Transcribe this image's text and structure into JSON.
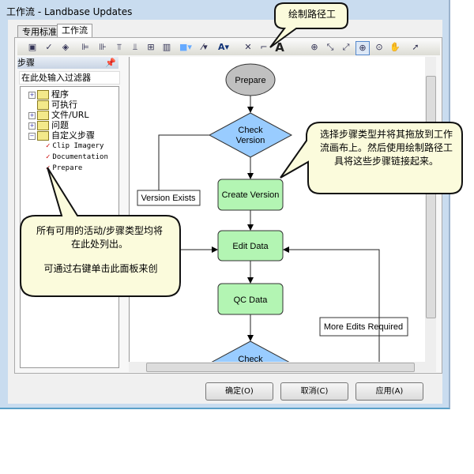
{
  "window": {
    "title": "工作流 - Landbase Updates"
  },
  "tabs": [
    {
      "label": "专用标准"
    },
    {
      "label": "工作流"
    }
  ],
  "steps_panel": {
    "header": "步骤",
    "filter_placeholder": "在此处输入过滤器",
    "tree": [
      {
        "label": "程序",
        "expandable": true
      },
      {
        "label": "可执行",
        "expandable": false
      },
      {
        "label": "文件/URL",
        "expandable": true
      },
      {
        "label": "问题",
        "expandable": true
      },
      {
        "label": "自定义步骤",
        "expanded": true,
        "children": [
          "Clip Imagery",
          "Documentation",
          "Prepare"
        ]
      }
    ]
  },
  "flow": {
    "prepare": "Prepare",
    "check_version_1": "Check",
    "check_version_2": "Version",
    "create_version": "Create Version",
    "edit_data": "Edit Data",
    "qc_data": "QC Data",
    "check": "Check",
    "version_exists": "Version Exists",
    "more_edits": "More Edits Required"
  },
  "callouts": {
    "draw_path": "绘制路径工",
    "right": "选择步骤类型并将其拖放到工作流画布上。然后使用绘制路径工具将这些步骤链接起来。",
    "left_1": "所有可用的活动/步骤类型均将在此处列出。",
    "left_2": "可通过右键单击此面板来创"
  },
  "buttons": {
    "ok": "确定(O)",
    "cancel": "取消(C)",
    "apply": "应用(A)"
  },
  "colors": {
    "decision": "#99ccff",
    "step": "#b3f5b3",
    "start": "#c0c0c0",
    "callout": "#fbfbdc"
  }
}
